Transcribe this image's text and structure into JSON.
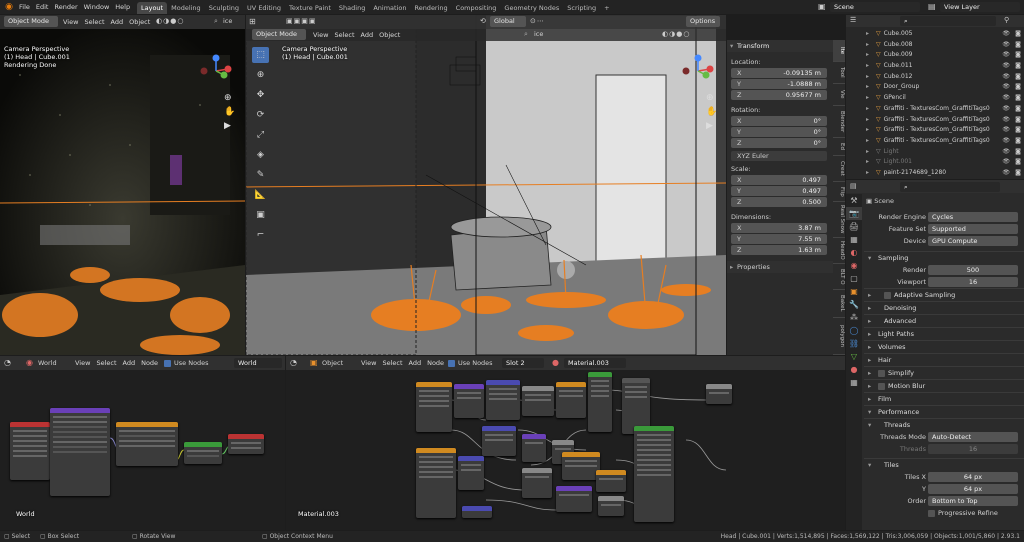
{
  "topbar": {
    "menus": [
      "File",
      "Edit",
      "Render",
      "Window",
      "Help"
    ],
    "workspaces": [
      "Layout",
      "Modeling",
      "Sculpting",
      "UV Editing",
      "Texture Paint",
      "Shading",
      "Animation",
      "Rendering",
      "Compositing",
      "Geometry Nodes",
      "Scripting"
    ],
    "active_workspace": "Layout",
    "add_tab": "+",
    "scene": "Scene",
    "view_layer": "View Layer"
  },
  "viewport_left": {
    "mode": "Object Mode",
    "menus": [
      "View",
      "Select",
      "Add",
      "Object"
    ],
    "orientation": "Global",
    "search_text": "ice",
    "overlay_lines": [
      "Camera Perspective",
      "(1) Head | Cube.001",
      "Rendering Done"
    ]
  },
  "viewport_right": {
    "mode": "Object Mode",
    "menus": [
      "View",
      "Select",
      "Add",
      "Object"
    ],
    "orientation": "Global",
    "search_text": "ice",
    "overlay_lines": [
      "Camera Perspective",
      "(1) Head | Cube.001"
    ],
    "options": "Options"
  },
  "transform_panel": {
    "title": "Transform",
    "location_label": "Location:",
    "location": [
      {
        "axis": "X",
        "value": "-0.09135 m"
      },
      {
        "axis": "Y",
        "value": "-1.0888 m"
      },
      {
        "axis": "Z",
        "value": "0.95677 m"
      }
    ],
    "rotation_label": "Rotation:",
    "rotation": [
      {
        "axis": "X",
        "value": "0°"
      },
      {
        "axis": "Y",
        "value": "0°"
      },
      {
        "axis": "Z",
        "value": "0°"
      }
    ],
    "rotation_mode": "XYZ Euler",
    "scale_label": "Scale:",
    "scale": [
      {
        "axis": "X",
        "value": "0.497"
      },
      {
        "axis": "Y",
        "value": "0.497"
      },
      {
        "axis": "Z",
        "value": "0.500"
      }
    ],
    "dimensions_label": "Dimensions:",
    "dimensions": [
      {
        "axis": "X",
        "value": "3.87 m"
      },
      {
        "axis": "Y",
        "value": "7.55 m"
      },
      {
        "axis": "Z",
        "value": "1.63 m"
      }
    ],
    "properties": "Properties"
  },
  "npanel_tabs": [
    "Ite",
    "Tool",
    "Vie",
    "Blender",
    "Ed",
    "Creat",
    "Flip",
    "Real Snow",
    "HeadO",
    "BLT O",
    "BakeL",
    "polygon"
  ],
  "outliner": {
    "items": [
      {
        "name": "Cube.005",
        "color": "#e6a040",
        "dim": false
      },
      {
        "name": "Cube.008",
        "color": "#e6a040",
        "dim": false
      },
      {
        "name": "Cube.009",
        "color": "#e6a040",
        "dim": false
      },
      {
        "name": "Cube.011",
        "color": "#e6a040",
        "dim": false
      },
      {
        "name": "Cube.012",
        "color": "#e6a040",
        "dim": false
      },
      {
        "name": "Door_Group",
        "color": "#e6a040",
        "dim": false
      },
      {
        "name": "GPencil",
        "color": "#e6a040",
        "dim": false
      },
      {
        "name": "Graffiti - TexturesCom_GraffitiTags0",
        "color": "#e6a040",
        "dim": false
      },
      {
        "name": "Graffiti - TexturesCom_GraffitiTags0",
        "color": "#e6a040",
        "dim": false
      },
      {
        "name": "Graffiti - TexturesCom_GraffitiTags0",
        "color": "#e6a040",
        "dim": false
      },
      {
        "name": "Graffiti - TexturesCom_GraffitiTags0",
        "color": "#e6a040",
        "dim": false
      },
      {
        "name": "Light",
        "color": "#888888",
        "dim": true
      },
      {
        "name": "Light.001",
        "color": "#888888",
        "dim": true
      },
      {
        "name": "paint-2174689_1280",
        "color": "#e6a040",
        "dim": false
      }
    ]
  },
  "properties": {
    "scene_label": "Scene",
    "render_engine_label": "Render Engine",
    "render_engine": "Cycles",
    "feature_set_label": "Feature Set",
    "feature_set": "Supported",
    "device_label": "Device",
    "device": "GPU Compute",
    "sampling": "Sampling",
    "render_label": "Render",
    "render_samples": "500",
    "viewport_label": "Viewport",
    "viewport_samples": "16",
    "adaptive_sampling": "Adaptive Sampling",
    "denoising": "Denoising",
    "advanced": "Advanced",
    "light_paths": "Light Paths",
    "volumes": "Volumes",
    "hair": "Hair",
    "simplify": "Simplify",
    "motion_blur": "Motion Blur",
    "film": "Film",
    "performance": "Performance",
    "threads": "Threads",
    "threads_mode_label": "Threads Mode",
    "threads_mode": "Auto-Detect",
    "threads_label": "Threads",
    "threads_value": "16",
    "tiles": "Tiles",
    "tiles_x_label": "Tiles X",
    "tiles_x": "64 px",
    "tiles_y_label": "Y",
    "tiles_y": "64 px",
    "order_label": "Order",
    "order": "Bottom to Top",
    "progressive": "Progressive Refine"
  },
  "node_left": {
    "type": "World",
    "menus": [
      "View",
      "Select",
      "Add",
      "Node"
    ],
    "use_nodes": "Use Nodes",
    "datablock": "World",
    "label": "World"
  },
  "node_right": {
    "type": "Object",
    "menus": [
      "View",
      "Select",
      "Add",
      "Node"
    ],
    "use_nodes": "Use Nodes",
    "slot": "Slot 2",
    "material": "Material.003",
    "label": "Material.003"
  },
  "statusbar": {
    "select": "Select",
    "box_select": "Box Select",
    "rotate_view": "Rotate View",
    "context_menu": "Object Context Menu",
    "stats": "Head | Cube.001 | Verts:1,514,895 | Faces:1,569,122 | Tris:3,006,059 | Objects:1,001/5,860 | 2.93.1"
  },
  "colors": {
    "accent": "#4772b3",
    "orange": "#e67e22",
    "header": "#303030",
    "panel": "#2b2b2b"
  }
}
